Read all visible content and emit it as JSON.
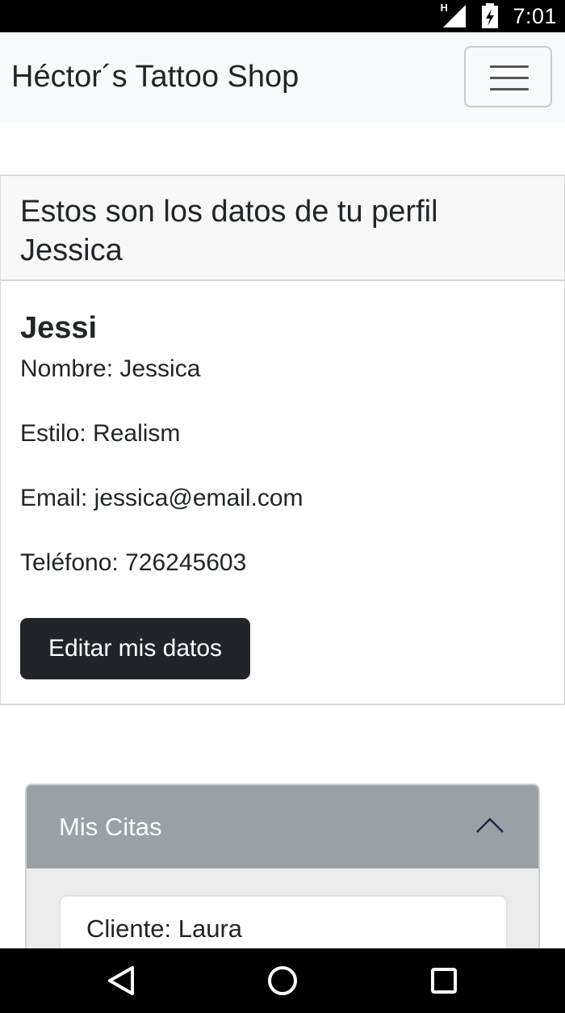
{
  "status_bar": {
    "time": "7:01",
    "signal_label": "H",
    "icons": [
      "signal-icon",
      "battery-charging-icon"
    ]
  },
  "navbar": {
    "brand": "Héctor´s Tattoo Shop",
    "menu_icon": "hamburger-menu-icon"
  },
  "profile": {
    "header": "Estos son los datos de tu perfil Jessica",
    "username": "Jessi",
    "nombre": "Nombre: Jessica",
    "estilo": "Estilo: Realism",
    "email": "Email: jessica@email.com",
    "telefono": "Teléfono: 726245603",
    "edit_button": "Editar mis datos"
  },
  "citas": {
    "title": "Mis Citas",
    "toggle_icon": "chevron-up-icon",
    "items": [
      {
        "cliente": "Cliente: Laura"
      }
    ]
  },
  "android_nav": {
    "buttons": [
      "back-icon",
      "home-icon",
      "recents-icon"
    ]
  },
  "colors": {
    "dark_button": "#212529",
    "accordion_header": "#9aa0a6",
    "navbar_bg": "#f8f9fa"
  }
}
